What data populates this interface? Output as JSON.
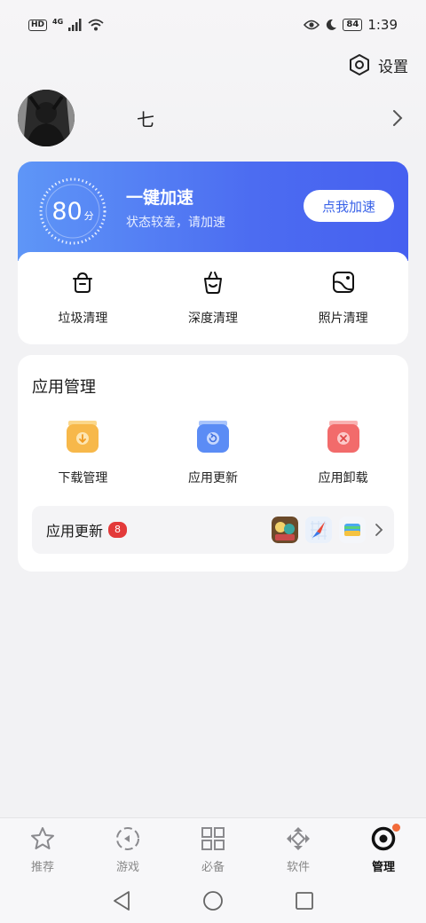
{
  "status_bar": {
    "hd": "HD",
    "network": "4G",
    "battery": "84",
    "time": "1:39"
  },
  "settings": {
    "label": "设置"
  },
  "profile": {
    "username": "七"
  },
  "boost": {
    "score": "80",
    "score_unit": "分",
    "title": "一键加速",
    "subtitle": "状态较差，请加速",
    "button": "点我加速"
  },
  "tools": [
    {
      "label": "垃圾清理",
      "icon": "trash-bin-icon"
    },
    {
      "label": "深度清理",
      "icon": "basket-icon"
    },
    {
      "label": "照片清理",
      "icon": "photo-icon"
    }
  ],
  "app_manage": {
    "title": "应用管理",
    "items": [
      {
        "label": "下载管理",
        "icon": "download-folder-icon",
        "color": "#f7b84a"
      },
      {
        "label": "应用更新",
        "icon": "update-folder-icon",
        "color": "#5b8cf5"
      },
      {
        "label": "应用卸载",
        "icon": "uninstall-icon",
        "color": "#f26b6b"
      }
    ],
    "update_row": {
      "label": "应用更新",
      "count": "8"
    }
  },
  "bottom_nav": [
    {
      "label": "推荐",
      "icon": "star-icon",
      "active": false
    },
    {
      "label": "游戏",
      "icon": "gamepad-icon",
      "active": false
    },
    {
      "label": "必备",
      "icon": "grid-icon",
      "active": false
    },
    {
      "label": "软件",
      "icon": "diamond-arrows-icon",
      "active": false
    },
    {
      "label": "管理",
      "icon": "manage-ring-icon",
      "active": true
    }
  ],
  "colors": {
    "accent": "#4c6cf1",
    "badge": "#e33a3a"
  }
}
